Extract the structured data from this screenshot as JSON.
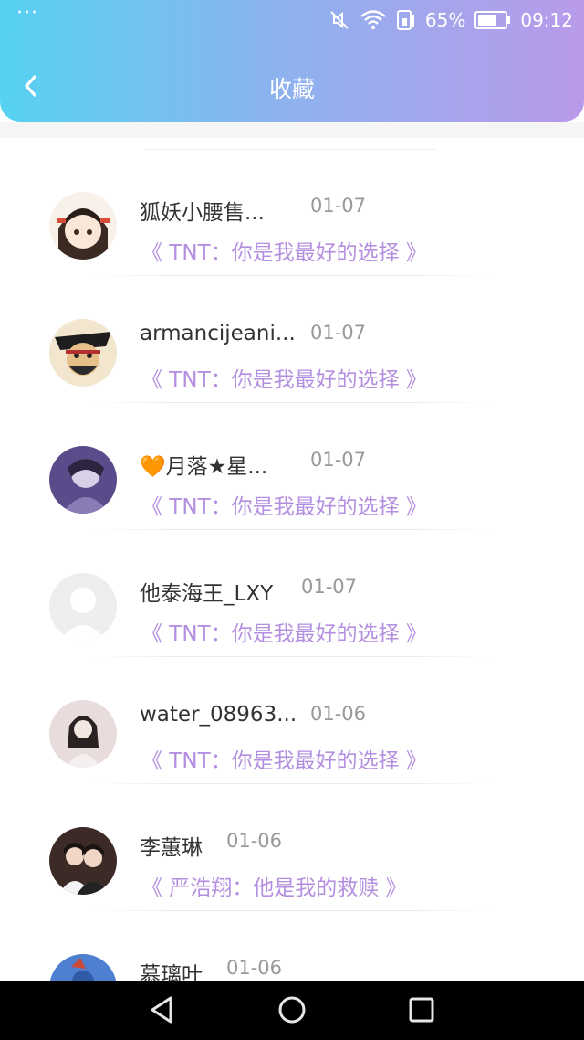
{
  "status_bar": {
    "dots": "···",
    "battery_percent": "65%",
    "time": "09:12"
  },
  "header": {
    "title": "收藏"
  },
  "items": [
    {
      "name": "狐妖小腰售...",
      "date": "01-07",
      "book": "《 TNT：你是我最好的选择 》"
    },
    {
      "name": "armancijeani...",
      "date": "01-07",
      "book": "《 TNT：你是我最好的选择 》"
    },
    {
      "name": "🧡月落★星...",
      "date": "01-07",
      "book": "《 TNT：你是我最好的选择 》"
    },
    {
      "name": "他泰海王_LXY",
      "date": "01-07",
      "book": "《 TNT：你是我最好的选择 》"
    },
    {
      "name": "water_08963...",
      "date": "01-06",
      "book": "《 TNT：你是我最好的选择 》"
    },
    {
      "name": "李蕙琳",
      "date": "01-06",
      "book": "《 严浩翔：他是我的救赎 》"
    },
    {
      "name": "慕璃叶",
      "date": "01-06",
      "book": ""
    }
  ],
  "colors": {
    "gradient_start": "#56d2f2",
    "gradient_end": "#b99aea",
    "book_title": "#b48fe0"
  }
}
